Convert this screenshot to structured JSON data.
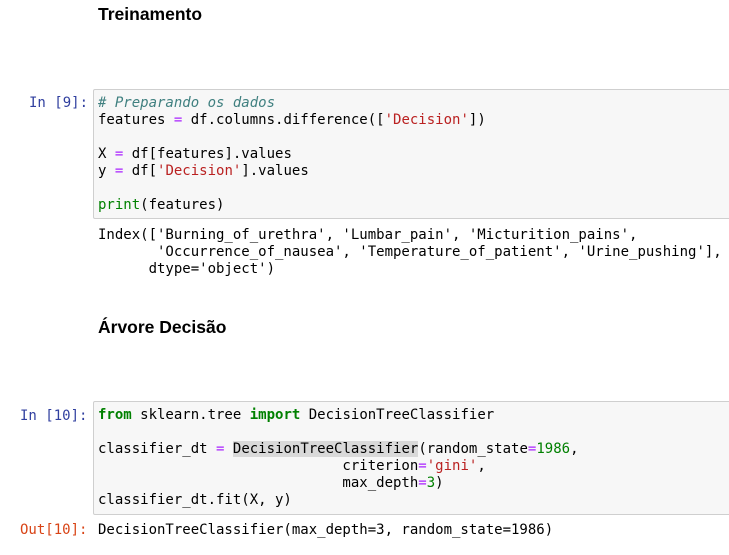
{
  "headings": {
    "treinamento": "Treinamento",
    "arvore": "Árvore Decisão"
  },
  "cell9": {
    "prompt": "In [9]:",
    "lines": [
      [
        {
          "t": "# Preparando os dados",
          "c": "cm"
        }
      ],
      [
        {
          "t": "features "
        },
        {
          "t": "=",
          "c": "op"
        },
        {
          "t": " df.columns.difference(["
        },
        {
          "t": "'Decision'",
          "c": "st"
        },
        {
          "t": "])"
        }
      ],
      [],
      [
        {
          "t": "X "
        },
        {
          "t": "=",
          "c": "op"
        },
        {
          "t": " df[features].values"
        }
      ],
      [
        {
          "t": "y "
        },
        {
          "t": "=",
          "c": "op"
        },
        {
          "t": " df["
        },
        {
          "t": "'Decision'",
          "c": "st"
        },
        {
          "t": "].values"
        }
      ],
      [],
      [
        {
          "t": "print",
          "c": "bi"
        },
        {
          "t": "(features)"
        }
      ]
    ],
    "output": "Index(['Burning_of_urethra', 'Lumbar_pain', 'Micturition_pains',\n       'Occurrence_of_nausea', 'Temperature_of_patient', 'Urine_pushing'],\n      dtype='object')"
  },
  "cell10": {
    "prompt": "In [10]:",
    "lines": [
      [
        {
          "t": "from",
          "c": "kw"
        },
        {
          "t": " sklearn.tree "
        },
        {
          "t": "import",
          "c": "kw"
        },
        {
          "t": " DecisionTreeClassifier"
        }
      ],
      [],
      [
        {
          "t": "classifier_dt "
        },
        {
          "t": "=",
          "c": "op"
        },
        {
          "t": " "
        },
        {
          "t": "DecisionTreeClassifier",
          "c": "hl"
        },
        {
          "t": "(random_state"
        },
        {
          "t": "=",
          "c": "op"
        },
        {
          "t": "1986",
          "c": "nm"
        },
        {
          "t": ","
        }
      ],
      [
        {
          "t": "                             criterion"
        },
        {
          "t": "=",
          "c": "op"
        },
        {
          "t": "'gini'",
          "c": "st"
        },
        {
          "t": ","
        }
      ],
      [
        {
          "t": "                             max_depth"
        },
        {
          "t": "=",
          "c": "op"
        },
        {
          "t": "3",
          "c": "nm"
        },
        {
          "t": ")"
        }
      ],
      [
        {
          "t": "classifier_dt.fit(X, y)"
        }
      ]
    ],
    "out_prompt": "Out[10]:",
    "output": "DecisionTreeClassifier(max_depth=3, random_state=1986)"
  }
}
